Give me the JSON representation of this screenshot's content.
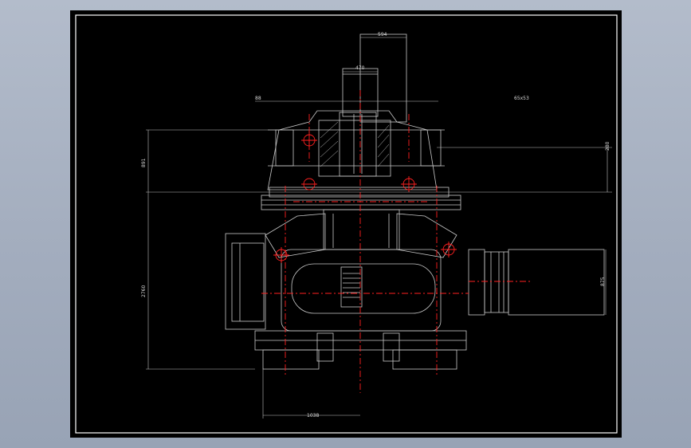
{
  "colors": {
    "background": "#a3adbe",
    "canvas": "#000000",
    "linework": "#c8c8c8",
    "centerline": "#ff2020",
    "frame": "#ffffff"
  },
  "drawing": {
    "dimensions": {
      "top_width": "594",
      "shaft_width": "470",
      "left_offset": "88",
      "right_offset": "65x53",
      "left_height_upper": "891",
      "right_height_upper": "280",
      "left_height_total": "2760",
      "right_height_drum": "875",
      "bottom_width": "1038"
    }
  }
}
